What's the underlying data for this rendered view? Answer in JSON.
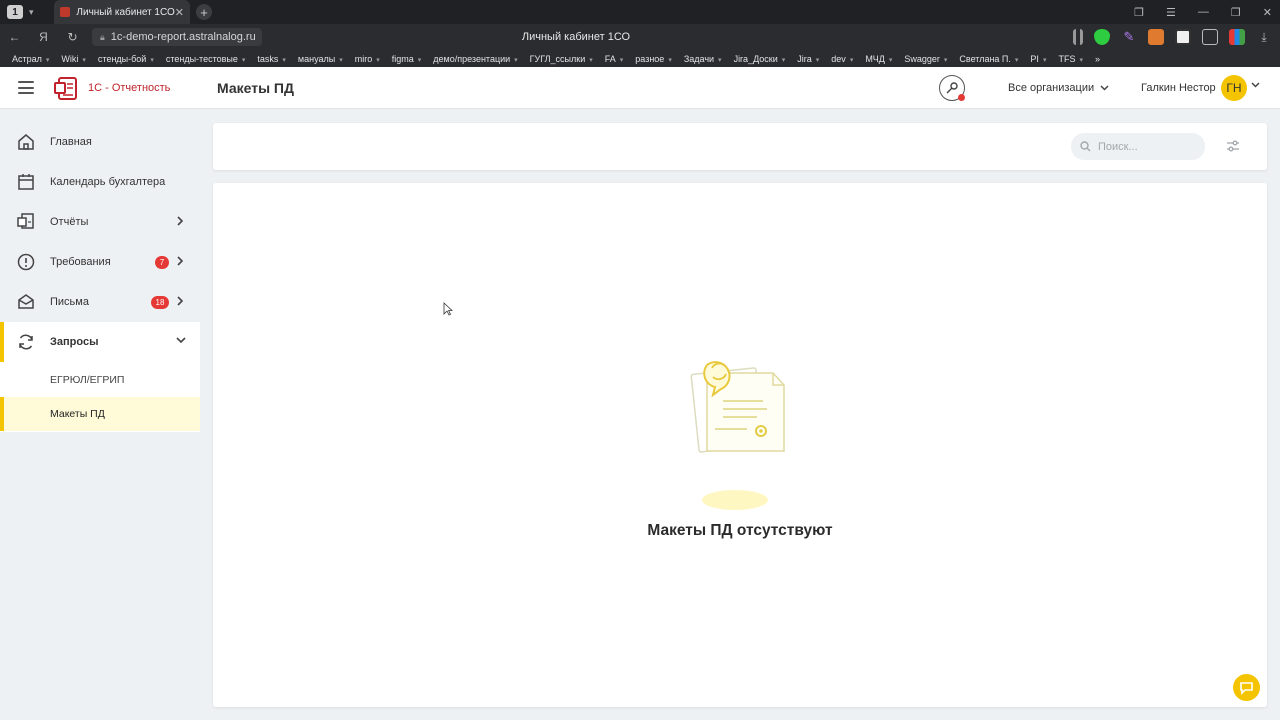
{
  "browser": {
    "tab_counter": "1",
    "tab_title": "Личный кабинет 1СО",
    "url": "1c-demo-report.astralnalog.ru",
    "page_title": "Личный кабинет 1СО",
    "bookmarks": [
      "Астрал",
      "Wiki",
      "стенды-бой",
      "стенды-тестовые",
      "tasks",
      "мануалы",
      "miro",
      "figma",
      "демо/презентации",
      "ГУГЛ_ссылки",
      "FA",
      "разное",
      "Задачи",
      "Jira_Доски",
      "Jira",
      "dev",
      "МЧД",
      "Swagger",
      "Светлана П.",
      "PI",
      "TFS"
    ],
    "bookmarks_more": "»"
  },
  "header": {
    "brand": "1С - Отчетность",
    "title": "Макеты ПД",
    "orgs_label": "Все организации",
    "user_name": "Галкин Нестор",
    "avatar_initials": "ГН"
  },
  "sidebar": {
    "items": [
      {
        "label": "Главная"
      },
      {
        "label": "Календарь бухгалтера"
      },
      {
        "label": "Отчёты"
      },
      {
        "label": "Требования",
        "badge": "7"
      },
      {
        "label": "Письма",
        "badge": "18"
      },
      {
        "label": "Запросы"
      }
    ],
    "sub_items": [
      {
        "label": "ЕГРЮЛ/ЕГРИП"
      },
      {
        "label": "Макеты ПД"
      }
    ]
  },
  "toolbar": {
    "search_placeholder": "Поиск..."
  },
  "main": {
    "empty_text": "Макеты ПД отсутствуют"
  },
  "colors": {
    "accent": "#f5c400",
    "brand_red": "#c0232b",
    "badge_red": "#e53935"
  }
}
